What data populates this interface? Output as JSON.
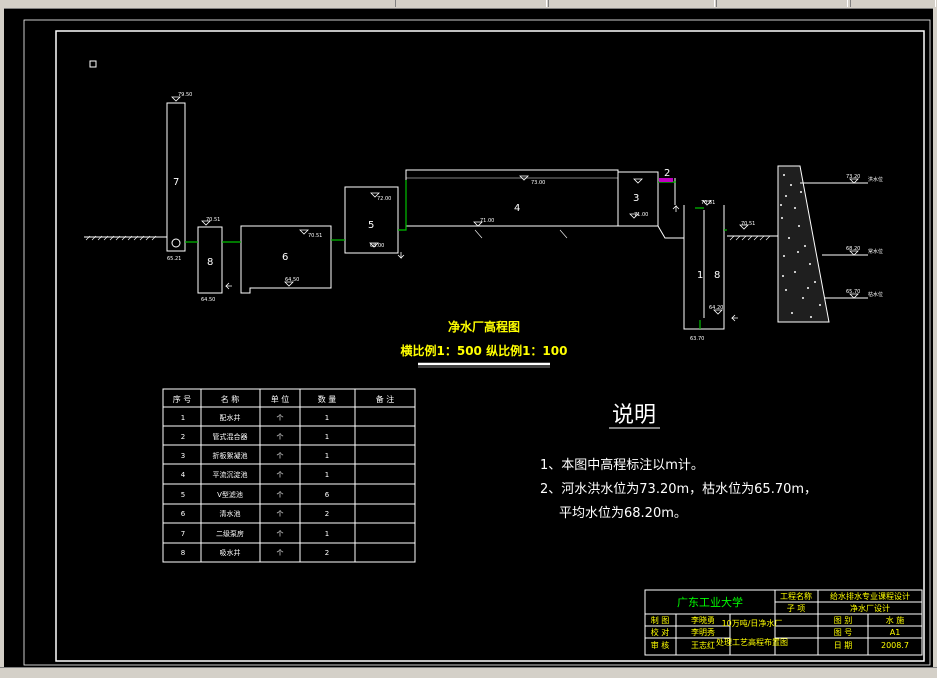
{
  "diagram": {
    "title": "净水厂高程图",
    "scale": "横比例1：500 纵比例1：100",
    "units": [
      {
        "num": "7",
        "elev": "79.50"
      },
      {
        "num": "8",
        "elev": "70.51",
        "elev_low": "64.50"
      },
      {
        "num": "6",
        "elev": "70.51",
        "elev_low": "64.50"
      },
      {
        "num": "5",
        "elev": "72.00",
        "elev_low": "68.00"
      },
      {
        "num": "4",
        "elev": "73.00",
        "elev_low": "71.00"
      },
      {
        "num": "3",
        "elev": "71.00"
      },
      {
        "num": "2"
      },
      {
        "num": "1"
      },
      {
        "num": "8",
        "elev": "70.51"
      },
      {
        "num": "",
        "elev": "70.51"
      }
    ],
    "levels": {
      "pump_base": "63.70",
      "river_ground": "70.51",
      "pump_low": "64.20",
      "inlet_low": "65.21",
      "river_flood": {
        "value": "73.20",
        "label": "洪水位"
      },
      "river_avg": {
        "value": "68.20",
        "label": "常水位"
      },
      "river_dry": {
        "value": "65.70",
        "label": "枯水位"
      }
    }
  },
  "table": {
    "headers": [
      "序 号",
      "名 称",
      "单 位",
      "数 量",
      "备 注"
    ],
    "rows": [
      [
        "1",
        "配水井",
        "个",
        "1",
        ""
      ],
      [
        "2",
        "管式混合器",
        "个",
        "1",
        ""
      ],
      [
        "3",
        "折板絮凝池",
        "个",
        "1",
        ""
      ],
      [
        "4",
        "平流沉淀池",
        "个",
        "1",
        ""
      ],
      [
        "5",
        "V型滤池",
        "个",
        "6",
        ""
      ],
      [
        "6",
        "清水池",
        "个",
        "2",
        ""
      ],
      [
        "7",
        "二级泵房",
        "个",
        "1",
        ""
      ],
      [
        "8",
        "吸水井",
        "个",
        "2",
        ""
      ]
    ]
  },
  "notes": {
    "title": "说明",
    "lines": [
      "1、本图中高程标注以m计。",
      "2、河水洪水位为73.20m，枯水位为65.70m，",
      "平均水位为68.20m。"
    ]
  },
  "titleblock": {
    "school": "广东工业大学",
    "project_label": "工程名称",
    "project": "给水排水专业课程设计",
    "sub_label": "子 项",
    "sub": "净水厂设计",
    "drawing_title_1": "10万吨/日净水厂",
    "drawing_title_2": "处理工艺高程布置图",
    "roles": [
      {
        "role": "制 图",
        "name": "李晓勇"
      },
      {
        "role": "校 对",
        "name": "李明秀"
      },
      {
        "role": "审 核",
        "name": "王志红"
      }
    ],
    "fields": [
      {
        "label": "图 别",
        "value": "水 施"
      },
      {
        "label": "图 号",
        "value": "A1"
      },
      {
        "label": "日 期",
        "value": "2008.7"
      }
    ]
  },
  "colors": {
    "title": "#ffff00",
    "pipe": "#00c000",
    "line": "#ffffff",
    "titleblock_green": "#00ff00",
    "titleblock_yellow": "#ffff00"
  }
}
